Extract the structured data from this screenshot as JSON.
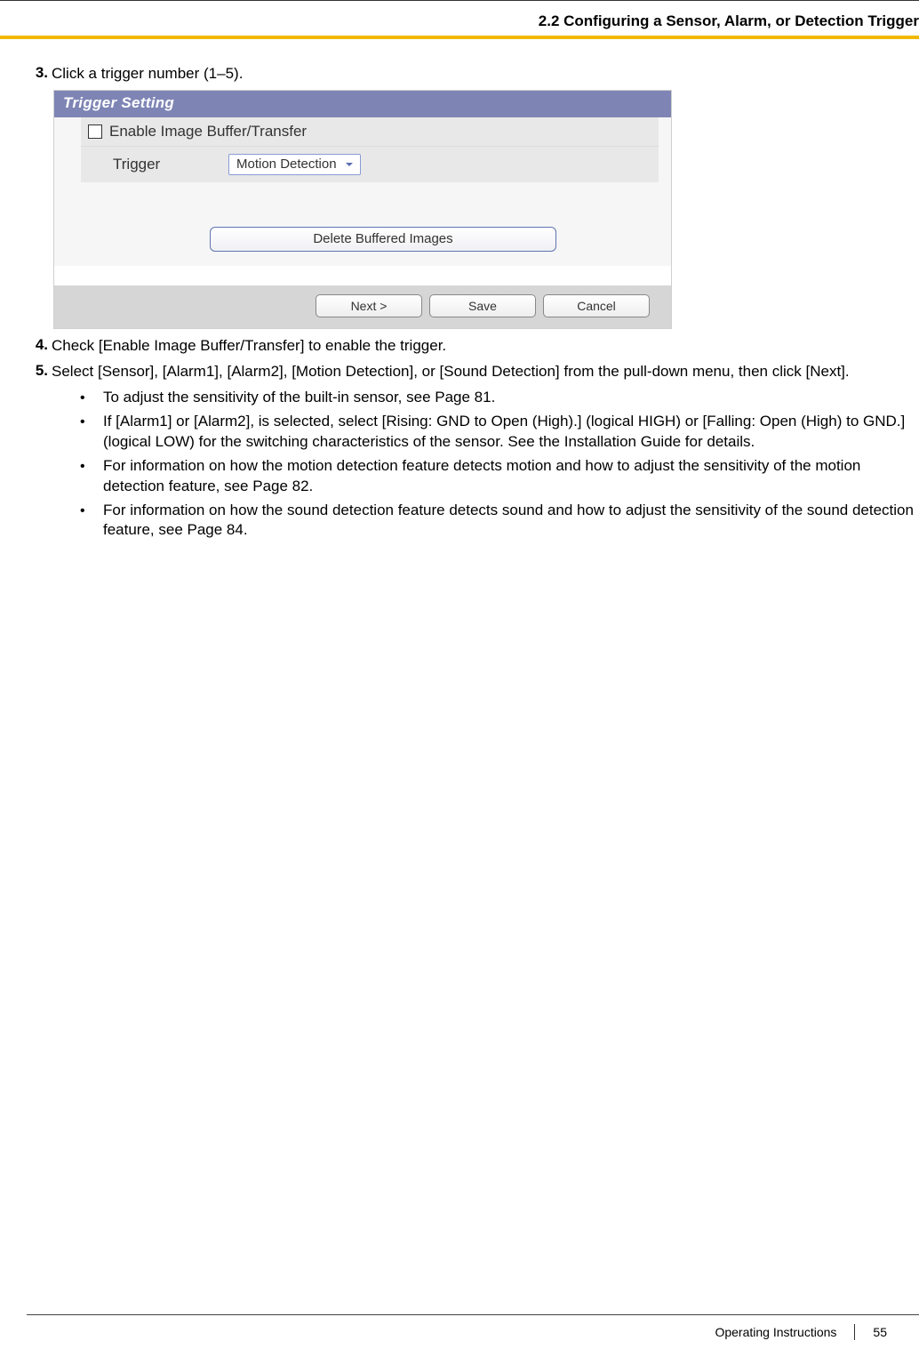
{
  "header": {
    "section_title": "2.2 Configuring a Sensor, Alarm, or Detection Trigger"
  },
  "steps": {
    "s3": {
      "n": "3.",
      "text": "Click a trigger number (1–5)."
    },
    "s4": {
      "n": "4.",
      "text": "Check [Enable Image Buffer/Transfer] to enable the trigger."
    },
    "s5": {
      "n": "5.",
      "text": "Select [Sensor], [Alarm1], [Alarm2], [Motion Detection], or [Sound Detection] from the pull-down menu, then click [Next]."
    }
  },
  "bullets": {
    "b1": "To adjust the sensitivity of the built-in sensor, see Page 81.",
    "b2": "If [Alarm1] or [Alarm2], is selected, select [Rising: GND to Open (High).] (logical HIGH) or [Falling: Open (High) to GND.] (logical LOW) for the switching characteristics of the sensor. See the Installation Guide for details.",
    "b3": "For information on how the motion detection feature detects motion and how to adjust the sensitivity of the motion detection feature, see Page 82.",
    "b4": "For information on how the sound detection feature detects sound and how to adjust the sensitivity of the sound detection feature, see Page 84."
  },
  "panel": {
    "title": "Trigger Setting",
    "enable_label": "Enable Image Buffer/Transfer",
    "trigger_label": "Trigger",
    "trigger_value": "Motion Detection",
    "delete_btn": "Delete Buffered Images",
    "next_btn": "Next >",
    "save_btn": "Save",
    "cancel_btn": "Cancel"
  },
  "footer": {
    "label": "Operating Instructions",
    "page": "55"
  }
}
